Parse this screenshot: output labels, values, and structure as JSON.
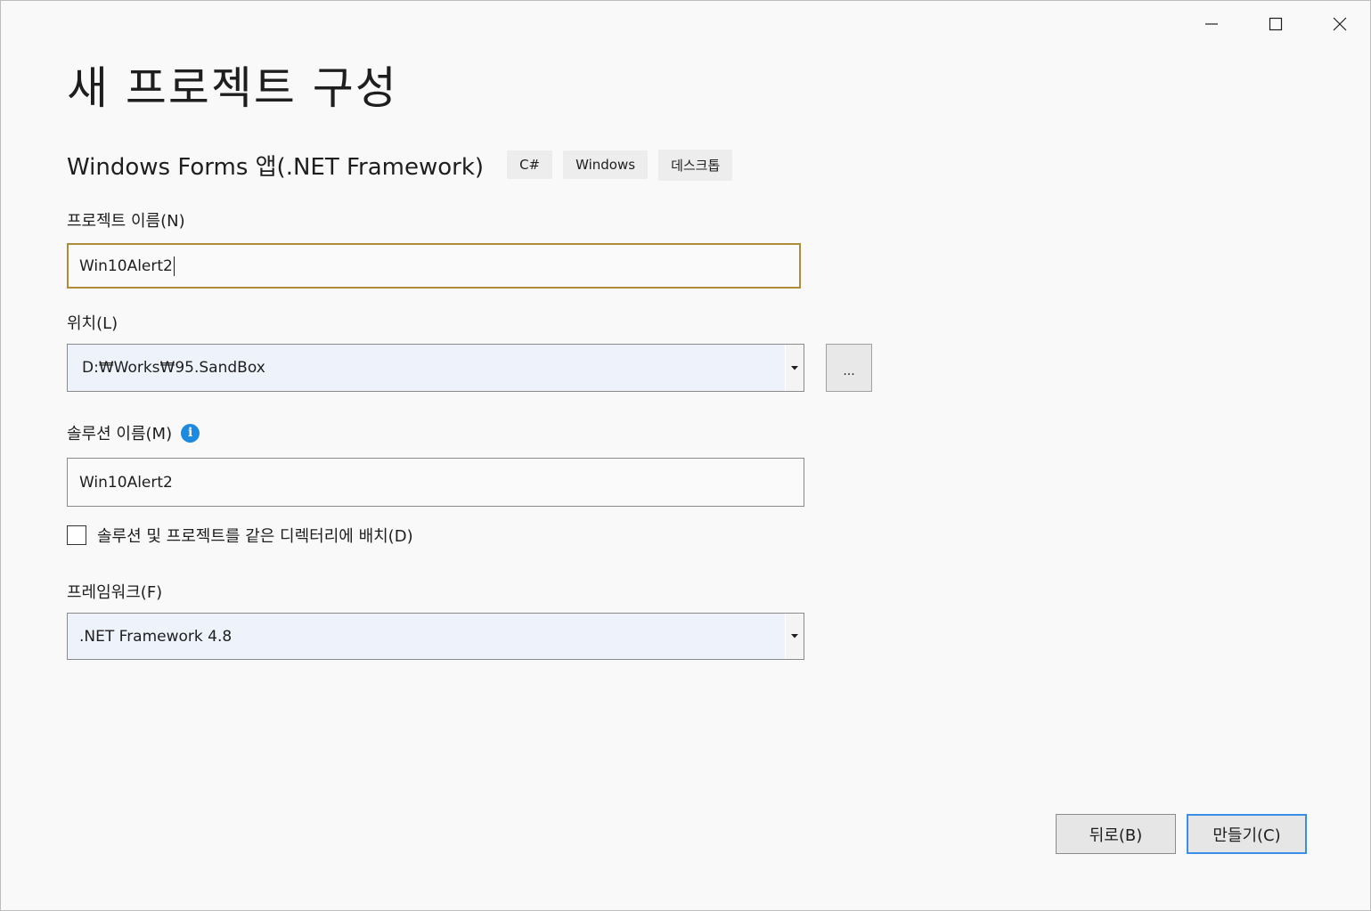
{
  "window": {
    "minimize_icon": "minimize-icon",
    "maximize_icon": "maximize-icon",
    "close_icon": "close-icon"
  },
  "page_title": "새 프로젝트 구성",
  "template": {
    "name": "Windows Forms 앱(.NET Framework)",
    "tags": [
      "C#",
      "Windows",
      "데스크톱"
    ]
  },
  "project_name": {
    "label": "프로젝트 이름(N)",
    "value": "Win10Alert2"
  },
  "location": {
    "label": "위치(L)",
    "value": "D:₩Works₩95.SandBox",
    "browse_label": "..."
  },
  "solution_name": {
    "label": "솔루션 이름(M)",
    "info_icon": "i",
    "value": "Win10Alert2"
  },
  "same_directory": {
    "label": "솔루션 및 프로젝트를 같은 디렉터리에 배치(D)",
    "checked": false
  },
  "framework": {
    "label": "프레임워크(F)",
    "value": ".NET Framework 4.8"
  },
  "buttons": {
    "back": "뒤로(B)",
    "create": "만들기(C)"
  },
  "colors": {
    "focus_border": "#b28b3a",
    "primary_border": "#3a8ee6",
    "info_blue": "#1d8ae0"
  }
}
